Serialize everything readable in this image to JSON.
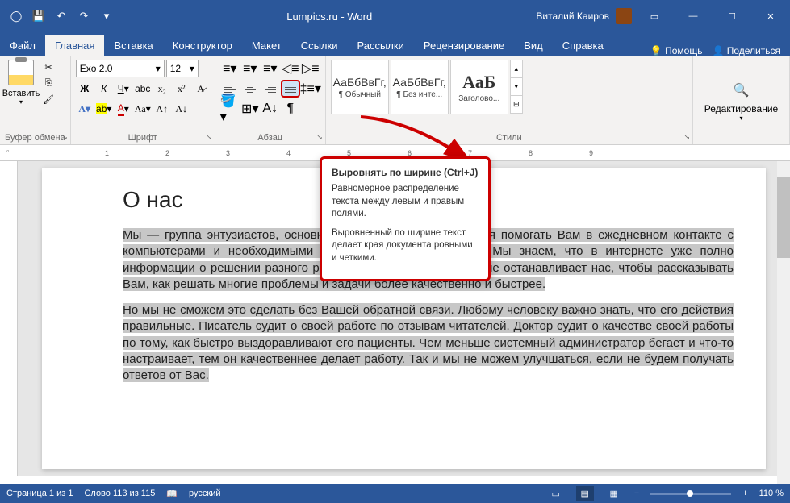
{
  "titlebar": {
    "doc_title": "Lumpics.ru - Word",
    "user_name": "Виталий Каиров"
  },
  "tabs": {
    "file": "Файл",
    "home": "Главная",
    "insert": "Вставка",
    "design": "Конструктор",
    "layout": "Макет",
    "references": "Ссылки",
    "mailings": "Рассылки",
    "review": "Рецензирование",
    "view": "Вид",
    "help": "Справка",
    "tell_me": "Помощь",
    "share": "Поделиться"
  },
  "ribbon": {
    "clipboard": {
      "label": "Буфер обмена",
      "paste": "Вставить"
    },
    "font": {
      "label": "Шрифт",
      "name": "Exo 2.0",
      "size": "12"
    },
    "paragraph": {
      "label": "Абзац"
    },
    "styles": {
      "label": "Стили",
      "items": [
        {
          "preview": "АаБбВвГг,",
          "name": "¶ Обычный"
        },
        {
          "preview": "АаБбВвГг,",
          "name": "¶ Без инте..."
        },
        {
          "preview": "АаБ",
          "name": "Заголово..."
        }
      ]
    },
    "editing": {
      "label": "Редактирование"
    }
  },
  "tooltip": {
    "title": "Выровнять по ширине (Ctrl+J)",
    "p1": "Равномерное распределение текста между левым и правым полями.",
    "p2": "Выровненный по ширине текст делает края документа ровными и четкими."
  },
  "document": {
    "heading": "О нас",
    "p1": "Мы — группа энтузиастов, основной задачей которых является помогать Вам в ежедневном контакте с компьютерами и необходимыми сервисами и программами. Мы знаем, что в интернете уже полно информации о решении разного рода проблем с ними. Но это не останавливает нас, чтобы рассказывать Вам, как решать многие проблемы и задачи более качественно и быстрее.",
    "p2": "Но мы не сможем это сделать без Вашей обратной связи. Любому человеку важно знать, что его действия правильные. Писатель судит о своей работе по отзывам читателей. Доктор судит о качестве своей работы по тому, как быстро выздоравливают его пациенты. Чем меньше системный администратор бегает и что-то настраивает, тем он качественнее делает работу. Так и мы не можем улучшаться, если не будем получать ответов от Вас."
  },
  "statusbar": {
    "page": "Страница 1 из 1",
    "words": "Слово 113 из 115",
    "language": "русский",
    "zoom": "110 %"
  }
}
